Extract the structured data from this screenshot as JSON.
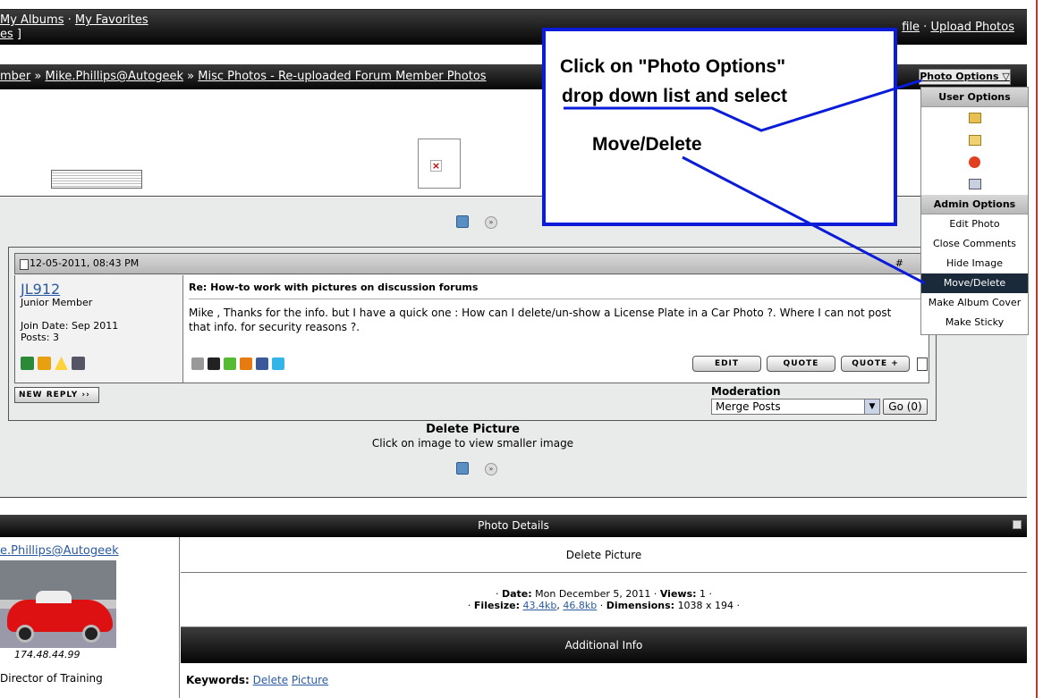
{
  "topnav": {
    "my_albums": "My Albums",
    "sep": " · ",
    "my_favorites": "My Favorites",
    "line2_link": "es",
    "line2_tail": " ]",
    "right_partial": "file",
    "right_sep": " · ",
    "upload_photos": "Upload Photos"
  },
  "breadcrumb": {
    "part1": "mber",
    "sep": " » ",
    "part2": "Mike.Phillips@Autogeek",
    "part3": "Misc Photos - Re-uploaded Forum Member Photos"
  },
  "photo_options": {
    "label": "Photo Options ▽",
    "user_options_header": "User Options",
    "admin_options_header": "Admin Options",
    "admin_items": [
      "Edit Photo",
      "Close Comments",
      "Hide Image",
      "Move/Delete",
      "Make Album Cover",
      "Make Sticky"
    ]
  },
  "callout": {
    "line1": "Click on \"Photo Options\"",
    "line2": "drop down list and select",
    "line3": "Move/Delete"
  },
  "post": {
    "date": "12-05-2011, 08:43 PM",
    "post_number": "#",
    "username": "JL912",
    "user_title": "Junior Member",
    "join_date": "Join Date: Sep 2011",
    "posts": "Posts: 3",
    "title": "Re: How-to work with pictures on discussion forums",
    "message": "Mike , Thanks for the info. but I have a quick one : How can I delete/un-show a License Plate in a Car Photo ?. Where I can not post that info. for security reasons ?.",
    "edit_label": "EDIT",
    "quote_label": "QUOTE",
    "quote_plus_label": "QUOTE +",
    "new_reply_label": "NEW REPLY"
  },
  "moderation": {
    "label": "Moderation",
    "selected": "Merge Posts",
    "go_label": "Go (0)"
  },
  "caption": {
    "title": "Delete Picture",
    "subtitle": "Click on image to view smaller image"
  },
  "details": {
    "header": "Photo Details",
    "owner_link": "e.Phillips@Autogeek",
    "ip": "174.48.44.99",
    "owner_title": "Director of Training",
    "photo_title": "Delete Picture",
    "date_label": "Date:",
    "date_value": "Mon December 5, 2011",
    "views_label": "Views:",
    "views_value": "1",
    "filesize_label": "Filesize:",
    "filesize_1": "43.4kb",
    "filesize_2": "46.8kb",
    "dimensions_label": "Dimensions:",
    "dimensions_value": "1038 x 194",
    "additional_header": "Additional Info",
    "keywords_label": "Keywords:",
    "keyword_1": "Delete",
    "keyword_2": "Picture"
  },
  "colors": {
    "callout_border": "#0a1cd8",
    "link": "#2a5aa0",
    "menu_selected": "#1a2a3a"
  }
}
